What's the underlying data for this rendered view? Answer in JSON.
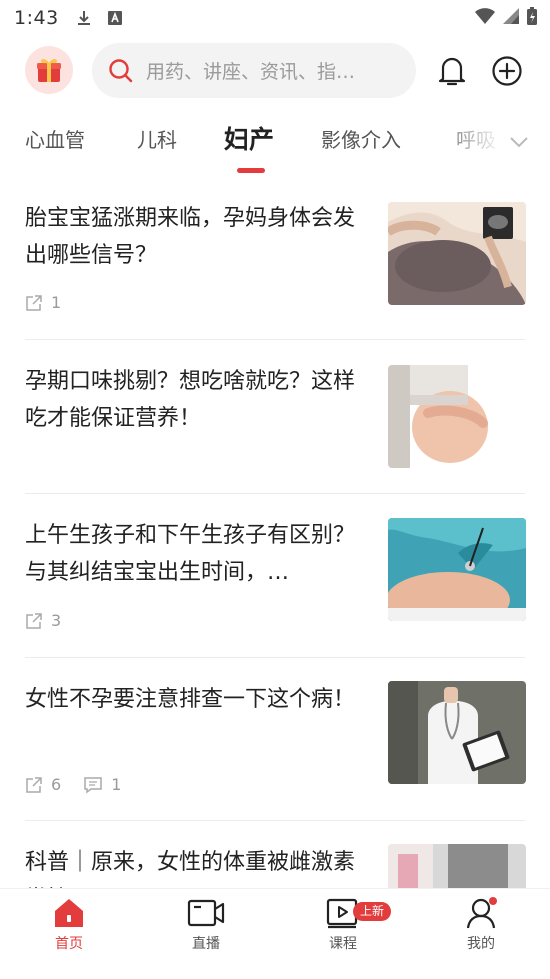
{
  "status_bar": {
    "time": "1:43"
  },
  "header": {
    "search_placeholder": "用药、讲座、资讯、指…"
  },
  "tabs": [
    {
      "label": "心血管"
    },
    {
      "label": "儿科"
    },
    {
      "label": "妇产"
    },
    {
      "label": "影像介入"
    },
    {
      "label": "呼吸"
    }
  ],
  "active_tab": "妇产",
  "articles": [
    {
      "title": "胎宝宝猛涨期来临，孕妈身体会发出哪些信号？",
      "shares": "1",
      "comments": null
    },
    {
      "title": "孕期口味挑剔？想吃啥就吃？这样吃才能保证营养！",
      "shares": null,
      "comments": null
    },
    {
      "title": "上午生孩子和下午生孩子有区别？与其纠结宝宝出生时间，…",
      "shares": "3",
      "comments": null
    },
    {
      "title": "女性不孕要注意排查一下这个病！",
      "shares": "6",
      "comments": "1"
    },
    {
      "title": "科普｜原来，女性的体重被雌激素掌控",
      "shares": null,
      "comments": null
    }
  ],
  "bottom_nav": [
    {
      "label": "首页",
      "icon": "home-icon"
    },
    {
      "label": "直播",
      "icon": "video-camera-icon"
    },
    {
      "label": "课程",
      "icon": "play-course-icon",
      "badge": "上新"
    },
    {
      "label": "我的",
      "icon": "profile-icon"
    }
  ],
  "colors": {
    "accent": "#e23c3c",
    "search_bg": "#f3f3f3",
    "gift_bg": "#fde3df"
  }
}
